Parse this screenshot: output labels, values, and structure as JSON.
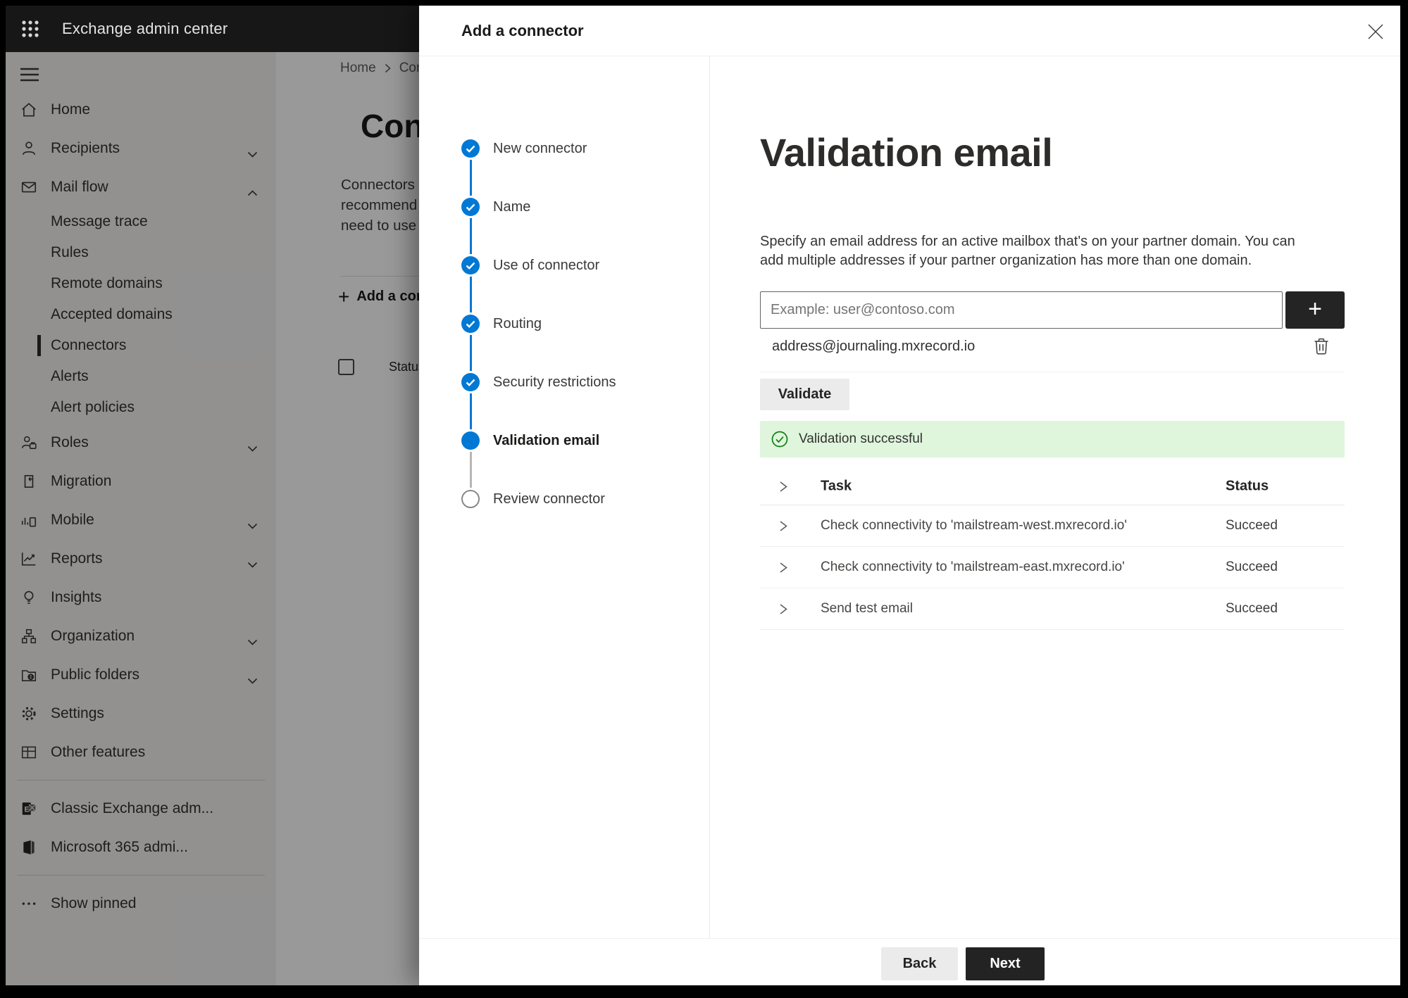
{
  "app": {
    "title": "Exchange admin center"
  },
  "sidebar": {
    "items": [
      {
        "kind": "item",
        "icon": "home-icon",
        "label": "Home"
      },
      {
        "kind": "item",
        "icon": "person-icon",
        "label": "Recipients",
        "chevron": "down"
      },
      {
        "kind": "item",
        "icon": "mail-icon",
        "label": "Mail flow",
        "chevron": "up"
      },
      {
        "kind": "sub",
        "label": "Message trace"
      },
      {
        "kind": "sub",
        "label": "Rules"
      },
      {
        "kind": "sub",
        "label": "Remote domains"
      },
      {
        "kind": "sub",
        "label": "Accepted domains"
      },
      {
        "kind": "sub",
        "label": "Connectors",
        "selected": true
      },
      {
        "kind": "sub",
        "label": "Alerts"
      },
      {
        "kind": "sub",
        "label": "Alert policies"
      },
      {
        "kind": "item",
        "icon": "roles-icon",
        "label": "Roles",
        "chevron": "down"
      },
      {
        "kind": "item",
        "icon": "migration-icon",
        "label": "Migration"
      },
      {
        "kind": "item",
        "icon": "mobile-icon",
        "label": "Mobile",
        "chevron": "down"
      },
      {
        "kind": "item",
        "icon": "reports-icon",
        "label": "Reports",
        "chevron": "down"
      },
      {
        "kind": "item",
        "icon": "insights-icon",
        "label": "Insights"
      },
      {
        "kind": "item",
        "icon": "organization-icon",
        "label": "Organization",
        "chevron": "down"
      },
      {
        "kind": "item",
        "icon": "public-folders-icon",
        "label": "Public folders",
        "chevron": "down"
      },
      {
        "kind": "item",
        "icon": "settings-icon",
        "label": "Settings"
      },
      {
        "kind": "item",
        "icon": "other-features-icon",
        "label": "Other features"
      },
      {
        "kind": "divider"
      },
      {
        "kind": "item",
        "icon": "classic-exchange-icon",
        "label": "Classic Exchange adm..."
      },
      {
        "kind": "item",
        "icon": "m365-icon",
        "label": "Microsoft 365 admi..."
      },
      {
        "kind": "divider"
      },
      {
        "kind": "item",
        "icon": "ellipsis-icon",
        "label": "Show pinned"
      }
    ]
  },
  "background": {
    "breadcrumb_home": "Home",
    "breadcrumb_current": "Conne",
    "heading": "Connec",
    "paragraph_lines": [
      "Connectors help",
      "recommend that",
      "need to use ther"
    ],
    "add_button": "Add a conn",
    "status_header": "Status"
  },
  "panel": {
    "title": "Add a connector",
    "steps": [
      {
        "label": "New connector",
        "state": "completed"
      },
      {
        "label": "Name",
        "state": "completed"
      },
      {
        "label": "Use of connector",
        "state": "completed"
      },
      {
        "label": "Routing",
        "state": "completed"
      },
      {
        "label": "Security restrictions",
        "state": "completed"
      },
      {
        "label": "Validation email",
        "state": "current"
      },
      {
        "label": "Review connector",
        "state": "upcoming"
      }
    ],
    "content": {
      "heading": "Validation email",
      "description": "Specify an email address for an active mailbox that's on your partner domain. You can add multiple addresses if your partner organization has more than one domain.",
      "email_input": {
        "placeholder": "Example: user@contoso.com",
        "value": ""
      },
      "addresses": [
        "address@journaling.mxrecord.io"
      ],
      "validate_button": "Validate",
      "success_message": "Validation successful",
      "table": {
        "columns": {
          "task": "Task",
          "status": "Status"
        },
        "rows": [
          {
            "task": "Check connectivity to 'mailstream-west.mxrecord.io'",
            "status": "Succeed"
          },
          {
            "task": "Check connectivity to 'mailstream-east.mxrecord.io'",
            "status": "Succeed"
          },
          {
            "task": "Send test email",
            "status": "Succeed"
          }
        ]
      }
    },
    "footer": {
      "back": "Back",
      "next": "Next"
    }
  },
  "colors": {
    "accent_blue": "#0078d4",
    "success_bg": "#dff6dd",
    "success_green": "#107c10",
    "dark_button": "#242424"
  }
}
